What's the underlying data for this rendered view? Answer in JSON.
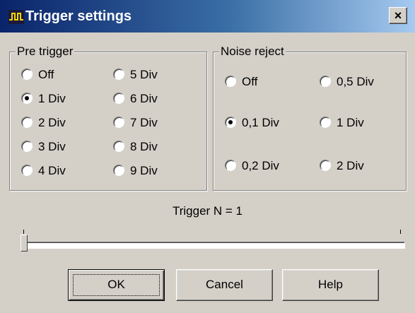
{
  "window": {
    "title": "Trigger settings",
    "close_label": "×"
  },
  "pre_trigger": {
    "title": "Pre trigger",
    "options": [
      "Off",
      "1 Div",
      "2 Div",
      "3 Div",
      "4 Div",
      "5 Div",
      "6 Div",
      "7 Div",
      "8 Div",
      "9 Div"
    ],
    "selected": "1 Div"
  },
  "noise_reject": {
    "title": "Noise reject",
    "options": [
      "Off",
      "0,1 Div",
      "0,2 Div",
      "0,5 Div",
      "1 Div",
      "2 Div"
    ],
    "selected": "0,1 Div"
  },
  "trigger_n": {
    "label": "Trigger N = 1",
    "value": 1
  },
  "buttons": {
    "ok": "OK",
    "cancel": "Cancel",
    "help": "Help"
  },
  "colors": {
    "title_bar_start": "#0a246a",
    "title_bar_end": "#a6caf0",
    "face": "#d4d0c8"
  }
}
